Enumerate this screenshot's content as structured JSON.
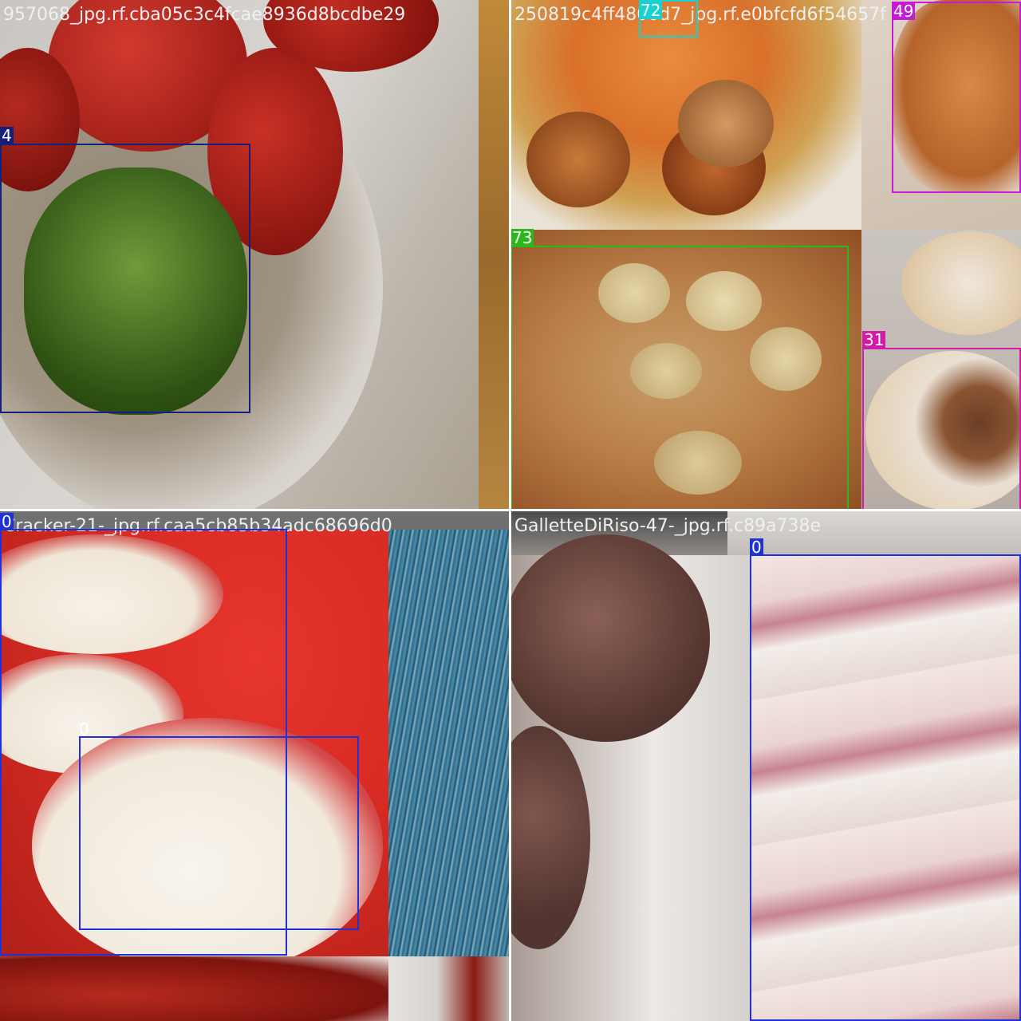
{
  "mosaic": {
    "tiles": [
      {
        "id": "top-left",
        "filename": "957068_jpg.rf.cba05c3c4fcae8936d8bcdbe29",
        "boxes": [
          {
            "label": "4",
            "color": "#14207a"
          }
        ]
      },
      {
        "id": "top-right",
        "filename": "250819c4ff4800d7_jpg.rf.e0bfcfd6f54657f",
        "boxes": [
          {
            "label": "72",
            "color": "#18d2d2"
          },
          {
            "label": "49",
            "color": "#c61ad6"
          },
          {
            "label": "73",
            "color": "#2ab81a"
          },
          {
            "label": "31",
            "color": "#d41aa8"
          }
        ]
      },
      {
        "id": "bottom-left",
        "filename": "Cracker-21-_jpg.rf.caa5cb85b34adc68696d0",
        "boxes": [
          {
            "label": "0",
            "color": "#1e32d8"
          },
          {
            "label": "0",
            "color": "#1e32d8"
          }
        ]
      },
      {
        "id": "bottom-right",
        "filename": "GalletteDiRiso-47-_jpg.rf.c89a738e",
        "boxes": [
          {
            "label": "0",
            "color": "#1e32d8"
          }
        ]
      }
    ]
  }
}
